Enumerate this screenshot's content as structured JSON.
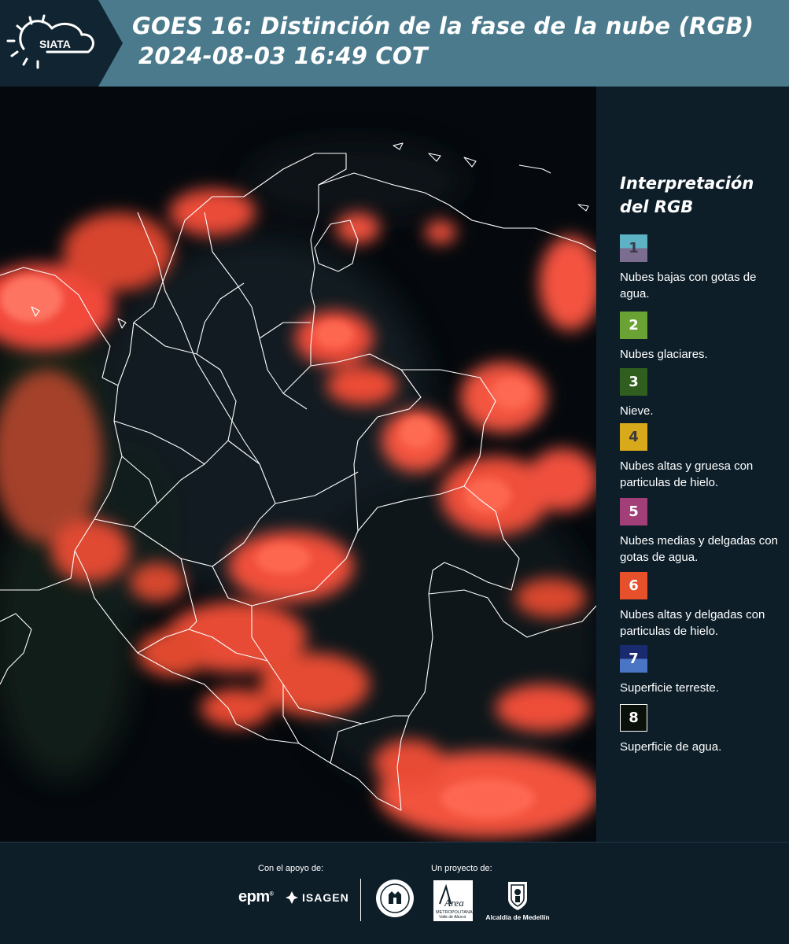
{
  "header": {
    "logo_text": "SIATA",
    "title_line1": "GOES 16: Distinción de la fase de la nube (RGB)",
    "title_line2": "2024-08-03 16:49 COT"
  },
  "legend": {
    "title_line1": "Interpretación",
    "title_line2": "del RGB",
    "items": [
      {
        "number": "1",
        "label": "Nubes bajas con gotas de agua.",
        "color_top": "#5db3c4",
        "color_bottom": "#7a6d8f",
        "text_color": "#3a3a4a"
      },
      {
        "number": "2",
        "label": "Nubes glaciares.",
        "color_top": "#6aa333",
        "color_bottom": "#6aa333",
        "text_color": "#ffffff"
      },
      {
        "number": "3",
        "label": "Nieve.",
        "color_top": "#2f5e1f",
        "color_bottom": "#2f5e1f",
        "text_color": "#ffffff"
      },
      {
        "number": "4",
        "label": "Nubes altas y gruesa con particulas de hielo.",
        "color_top": "#d9a91c",
        "color_bottom": "#d9a91c",
        "text_color": "#3a3a3a"
      },
      {
        "number": "5",
        "label": "Nubes medias y delgadas con gotas de agua.",
        "color_top": "#a23f78",
        "color_bottom": "#a23f78",
        "text_color": "#ffffff"
      },
      {
        "number": "6",
        "label": "Nubes altas y delgadas con particulas de hielo.",
        "color_top": "#e6502a",
        "color_bottom": "#e6502a",
        "text_color": "#ffffff"
      },
      {
        "number": "7",
        "label": "Superficie terreste.",
        "color_top": "#1a2a6e",
        "color_bottom": "#4a74c4",
        "text_color": "#ffffff"
      },
      {
        "number": "8",
        "label": "Superficie de agua.",
        "color_top": "#0a100a",
        "color_bottom": "#0a100a",
        "text_color": "#ffffff"
      }
    ]
  },
  "footer": {
    "support_label": "Con el apoyo de:",
    "project_label": "Un proyecto de:",
    "epm": "epm",
    "epm_mark": "®",
    "isagen": "ISAGEN",
    "area": "Área",
    "area_sub1": "METROPOLITANA",
    "area_sub2": "Valle de Aburrá",
    "alcaldia": "Alcaldía de Medellín"
  }
}
